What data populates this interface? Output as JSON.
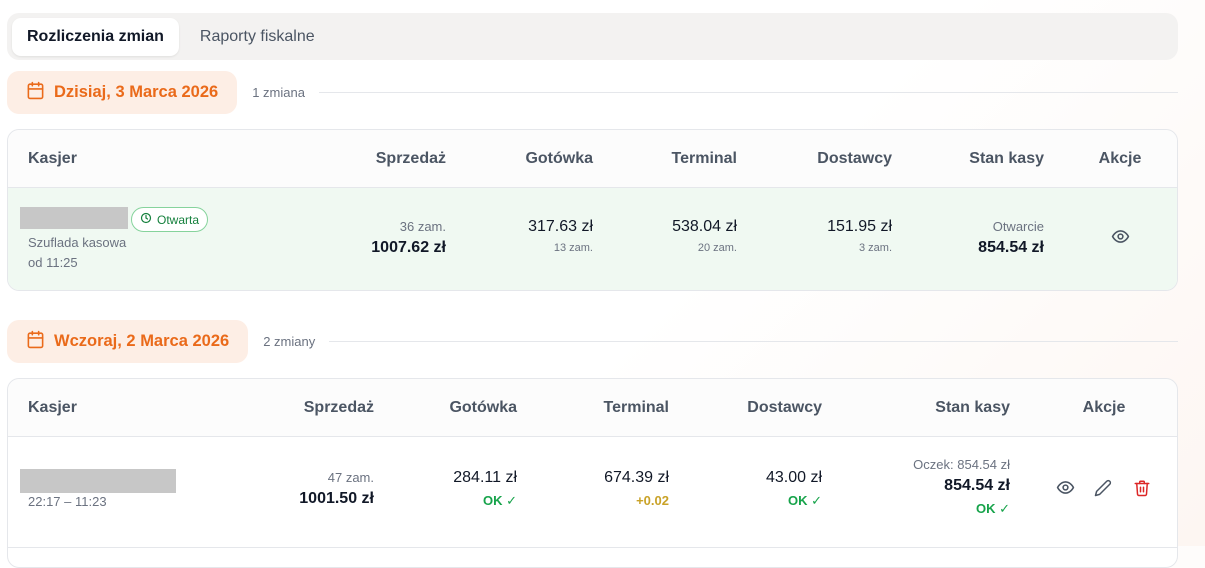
{
  "tabs": [
    {
      "label": "Rozliczenia zmian",
      "active": true
    },
    {
      "label": "Raporty fiskalne",
      "active": false
    }
  ],
  "columns": {
    "cashier": "Kasjer",
    "sales": "Sprzedaż",
    "cash": "Gotówka",
    "terminal": "Terminal",
    "suppliers": "Dostawcy",
    "register": "Stan kasy",
    "actions": "Akcje"
  },
  "groups": [
    {
      "date_label": "Dzisiaj, 3 Marca 2026",
      "count_label": "1 zmiana",
      "rows": [
        {
          "status_badge": "Otwarta",
          "drawer": "Szuflada kasowa",
          "since": "od 11:25",
          "sales_orders": "36 zam.",
          "sales_total": "1007.62 zł",
          "cash": "317.63 zł",
          "cash_orders": "13 zam.",
          "terminal": "538.04 zł",
          "terminal_orders": "20 zam.",
          "suppliers": "151.95 zł",
          "suppliers_orders": "3 zam.",
          "register_label": "Otwarcie",
          "register_value": "854.54 zł"
        }
      ]
    },
    {
      "date_label": "Wczoraj, 2 Marca 2026",
      "count_label": "2 zmiany",
      "rows": [
        {
          "time_range": "22:17 – 11:23",
          "sales_orders": "47 zam.",
          "sales_total": "1001.50 zł",
          "cash": "284.11 zł",
          "cash_status": "OK ✓",
          "terminal": "674.39 zł",
          "terminal_status": "+0.02",
          "suppliers": "43.00 zł",
          "suppliers_status": "OK ✓",
          "register_expected": "Oczek: 854.54 zł",
          "register_value": "854.54 zł",
          "register_status": "OK ✓"
        }
      ]
    }
  ],
  "icons": {
    "calendar": "calendar-icon",
    "view": "eye-icon",
    "edit": "pencil-icon",
    "delete": "trash-icon",
    "clock": "clock-icon"
  },
  "colors": {
    "accent": "#ea6a1a",
    "ok": "#16a34a",
    "warn": "#c9a227",
    "danger": "#dc2626",
    "open_row": "#f0f9f2"
  }
}
